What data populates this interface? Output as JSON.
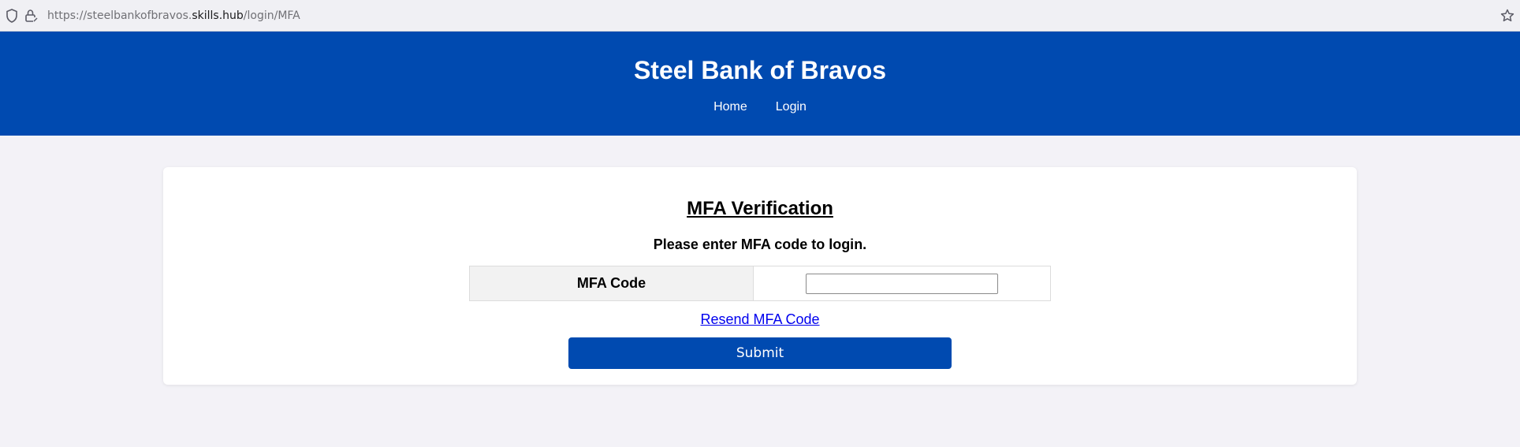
{
  "browser": {
    "url_prefix": "https://steelbankofbravos.",
    "url_host": "skills.hub",
    "url_path": "/login/MFA"
  },
  "header": {
    "title": "Steel Bank of Bravos",
    "nav": [
      {
        "label": "Home"
      },
      {
        "label": "Login"
      }
    ]
  },
  "card": {
    "title": "MFA Verification",
    "instruction": "Please enter MFA code to login.",
    "field_label": "MFA Code",
    "field_value": "",
    "resend_label": "Resend MFA Code",
    "submit_label": "Submit"
  },
  "colors": {
    "brand_blue": "#004ab0",
    "page_bg": "#f3f2f7",
    "link": "#0000ee"
  },
  "icons": [
    "shield-icon",
    "lock-icon",
    "star-icon"
  ]
}
